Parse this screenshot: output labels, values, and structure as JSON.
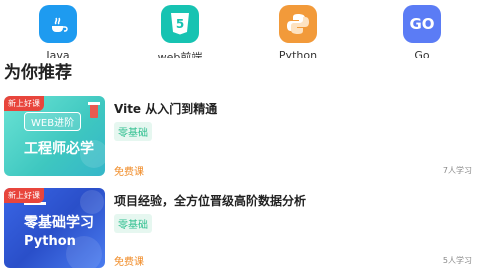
{
  "categories": [
    {
      "label": "Java",
      "icon": "java-icon",
      "color": "#1e9bf0"
    },
    {
      "label": "web前端",
      "icon": "html5-icon",
      "color": "#17c3b2"
    },
    {
      "label": "Python",
      "icon": "python-icon",
      "color": "#f29a3a"
    },
    {
      "label": "Go",
      "icon": "go-icon",
      "color": "#5b7cf5"
    }
  ],
  "section_title": "为你推荐",
  "courses": [
    {
      "tag": "新上好课",
      "thumb_pill": "WEB进阶",
      "thumb_big": "工程师必学",
      "title": "Vite 从入门到精通",
      "level": "零基础",
      "price": "免费课",
      "learners": "7人学习"
    },
    {
      "tag": "新上好课",
      "thumb_line1": "零基础学习",
      "thumb_line2": "Python",
      "title": "项目经验，全方位晋级高阶数据分析",
      "level": "零基础",
      "price": "免费课",
      "learners": "5人学习"
    }
  ]
}
